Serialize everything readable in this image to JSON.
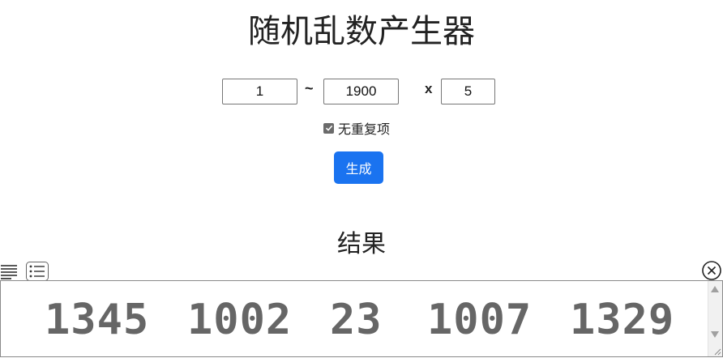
{
  "page": {
    "title": "随机乱数产生器"
  },
  "range": {
    "min_value": "1",
    "separator": "~",
    "max_value": "1900",
    "times_label": "x",
    "count_value": "5"
  },
  "options": {
    "unique_label": "无重复项",
    "unique_checked": true
  },
  "actions": {
    "generate_label": "生成"
  },
  "result": {
    "heading": "结果",
    "numbers": [
      "1345",
      "1002",
      "23",
      "1007",
      "1329"
    ]
  },
  "icons": {
    "toolbar": [
      "align-text-icon",
      "bullet-list-icon"
    ],
    "close": "close-circle-icon"
  },
  "colors": {
    "accent": "#1a73f0",
    "result_text": "#666666"
  }
}
